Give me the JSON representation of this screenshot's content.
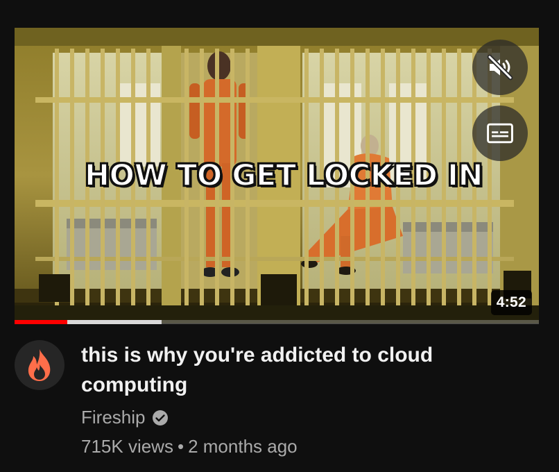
{
  "video": {
    "thumbnail_text": "HOW TO GET LOCKED IN",
    "duration": "4:52",
    "progress": {
      "played": 0.1,
      "buffered": 0.28
    },
    "controls": {
      "mute_icon": "volume-muted-icon",
      "captions_icon": "captions-icon"
    }
  },
  "details": {
    "title": "this is why you're addicted to cloud computing",
    "channel": "Fireship",
    "verified_icon": "verified-check-icon",
    "avatar_icon": "flame-icon",
    "views": "715K views",
    "separator": "•",
    "age": "2 months ago"
  },
  "colors": {
    "background": "#0f0f0f",
    "progress_played": "#ff0000",
    "brand_flame": "#ff6e4a",
    "secondary_text": "#aaaaaa"
  }
}
